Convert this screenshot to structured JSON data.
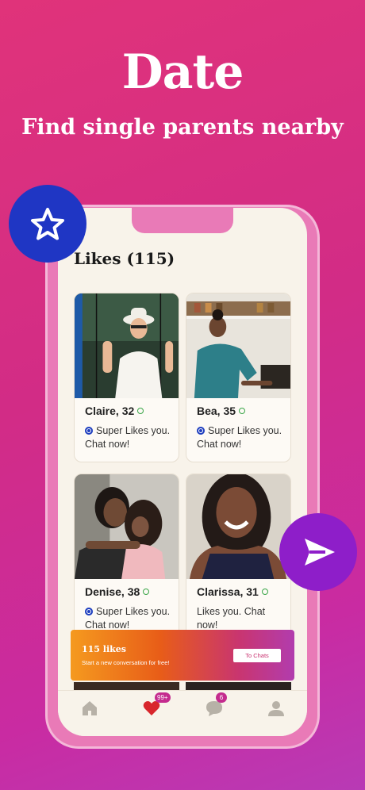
{
  "headline": "Date",
  "subheadline": "Find single parents nearby",
  "likes_title": "Likes (115)",
  "cards": [
    {
      "name": "Claire, 32",
      "text": "Super Likes you. Chat now!",
      "super_like": true,
      "online": true
    },
    {
      "name": "Bea, 35",
      "text": "Super Likes you. Chat now!",
      "super_like": true,
      "online": true
    },
    {
      "name": "Denise, 38",
      "text": "Super Likes you. Chat now!",
      "super_like": true,
      "online": true
    },
    {
      "name": "Clarissa, 31",
      "text": "Likes you. Chat now!",
      "super_like": false,
      "online": true
    }
  ],
  "banner": {
    "title": "115 likes",
    "subtitle": "Start a new conversation for free!",
    "button": "To Chats"
  },
  "tabbar": {
    "likes_badge": "99+",
    "chat_badge": "6"
  },
  "colors": {
    "accent_pink": "#c42b8e",
    "star_button": "#1f36c4",
    "send_button": "#8e1ec9"
  }
}
